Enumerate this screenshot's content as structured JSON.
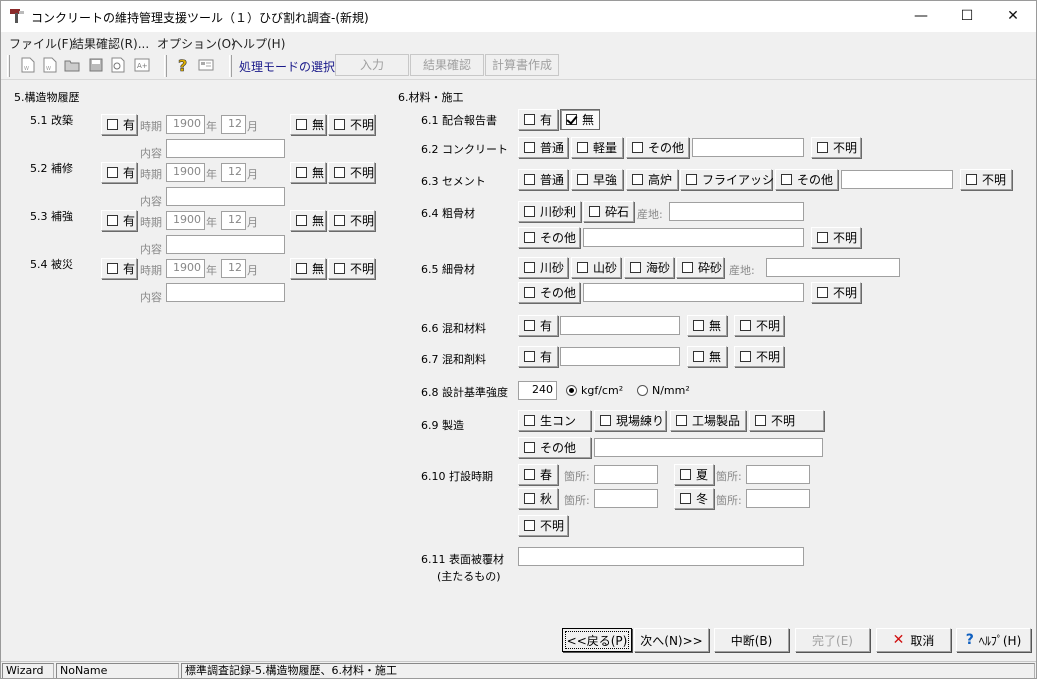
{
  "window": {
    "title": "コンクリートの維持管理支援ツール（１）ひび割れ調査-(新規)",
    "minimize": "—",
    "maximize": "☐",
    "close": "✕"
  },
  "menu": [
    "ファイル(F)",
    "結果確認(R)...",
    "オプション(O)",
    "ヘルプ(H)"
  ],
  "toolbar": {
    "mode_label": "処理モードの選択",
    "modes": [
      "入力",
      "結果確認",
      "計算書作成"
    ]
  },
  "section5": {
    "heading": "5.構造物履歴",
    "rows": [
      {
        "label": "5.1 改築",
        "yes": "有",
        "period": "時期",
        "year": "1900",
        "year_unit": "年",
        "month": "12",
        "month_unit": "月",
        "none": "無",
        "unknown": "不明",
        "content": "内容"
      },
      {
        "label": "5.2 補修",
        "yes": "有",
        "period": "時期",
        "year": "1900",
        "year_unit": "年",
        "month": "12",
        "month_unit": "月",
        "none": "無",
        "unknown": "不明",
        "content": "内容"
      },
      {
        "label": "5.3 補強",
        "yes": "有",
        "period": "時期",
        "year": "1900",
        "year_unit": "年",
        "month": "12",
        "month_unit": "月",
        "none": "無",
        "unknown": "不明",
        "content": "内容"
      },
      {
        "label": "5.4 被災",
        "yes": "有",
        "period": "時期",
        "year": "1900",
        "year_unit": "年",
        "month": "12",
        "month_unit": "月",
        "none": "無",
        "unknown": "不明",
        "content": "内容"
      }
    ]
  },
  "section6": {
    "heading": "6.材料・施工",
    "s61": {
      "label": "6.1 配合報告書",
      "yes": "有",
      "none": "無"
    },
    "s62": {
      "label": "6.2 コンクリート",
      "opts": [
        "普通",
        "軽量",
        "その他"
      ],
      "unknown": "不明"
    },
    "s63": {
      "label": "6.3 セメント",
      "opts": [
        "普通",
        "早強",
        "高炉",
        "フライアッシュ",
        "その他"
      ],
      "unknown": "不明"
    },
    "s64": {
      "label": "6.4 粗骨材",
      "opts": [
        "川砂利",
        "砕石"
      ],
      "origin": "産地:",
      "other": "その他",
      "unknown": "不明"
    },
    "s65": {
      "label": "6.5 細骨材",
      "opts": [
        "川砂",
        "山砂",
        "海砂",
        "砕砂"
      ],
      "origin": "産地:",
      "other": "その他",
      "unknown": "不明"
    },
    "s66": {
      "label": "6.6 混和材料",
      "yes": "有",
      "none": "無",
      "unknown": "不明"
    },
    "s67": {
      "label": "6.7 混和剤料",
      "yes": "有",
      "none": "無",
      "unknown": "不明"
    },
    "s68": {
      "label": "6.8 設計基準強度",
      "value": "240",
      "unit1": "kgf/cm²",
      "unit2": "N/mm²"
    },
    "s69": {
      "label": "6.9 製造",
      "opts": [
        "生コン",
        "現場練り",
        "工場製品",
        "不明"
      ],
      "other": "その他"
    },
    "s610": {
      "label": "6.10 打設時期",
      "spring": "春",
      "summer": "夏",
      "autumn": "秋",
      "winter": "冬",
      "place": "箇所:",
      "unknown": "不明"
    },
    "s611": {
      "label": "6.11 表面被覆材",
      "sub": "(主たるもの)"
    }
  },
  "buttons": {
    "back": "<<戻る(P)",
    "next": "次へ(N)>>",
    "suspend": "中断(B)",
    "finish": "完了(E)",
    "cancel": "取消",
    "help": "ﾍﾙﾌﾟ(H)"
  },
  "status": [
    "Wizard",
    "NoName",
    "標準調査記録-5.構造物履歴、6.材料・施工"
  ]
}
